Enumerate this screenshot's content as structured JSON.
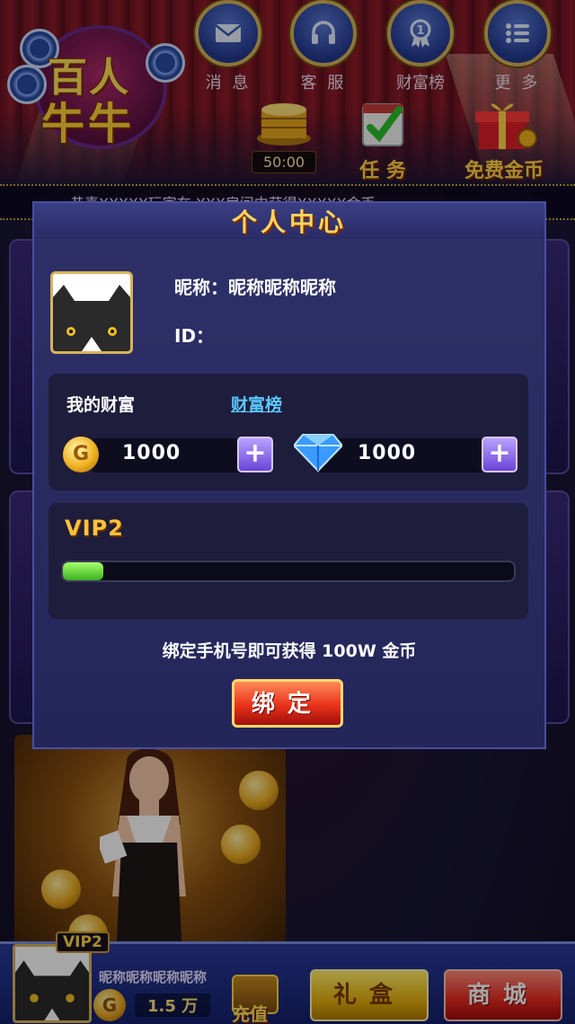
{
  "top_nav": {
    "messages_label": "消 息",
    "service_label": "客 服",
    "ranking_label": "财富榜",
    "more_label": "更 多"
  },
  "logo": {
    "line1": "百人",
    "line2": "牛牛"
  },
  "features": {
    "timer": "50:00",
    "task_label": "任 务",
    "free_gold_label": "免费金币"
  },
  "marquee": {
    "text": "恭喜XXXXX玩家在 XXX房间中获得XXXXX金币"
  },
  "modal": {
    "title": "个人中心",
    "nickname_line": "昵称：昵称昵称昵称",
    "id_line": "ID：",
    "wealth": {
      "title": "我的财富",
      "ranking_link": "财富榜",
      "gold_value": "1000",
      "gold_icon_glyph": "G",
      "diamond_value": "1000"
    },
    "vip": {
      "level_label": "VIP2",
      "progress": 0.09
    },
    "bind_tip": "绑定手机号即可获得 100W 金币",
    "bind_button": "绑定"
  },
  "bottom_bar": {
    "vip_tag": "VIP2",
    "nickname": "昵称昵称昵称昵称",
    "gold_amount": "1.5 万",
    "gold_icon_glyph": "G",
    "recharge_label": "充值",
    "gift_button": "礼盒",
    "shop_button": "商城"
  },
  "colors": {
    "accent_gold": "#ffd45a",
    "link_blue": "#5ac8ff",
    "progress_green": "#3ab020",
    "bind_red": "#e8321a"
  }
}
